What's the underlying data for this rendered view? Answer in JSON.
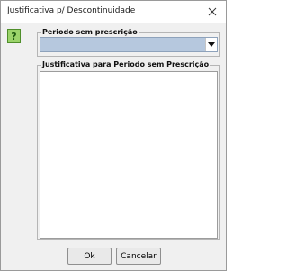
{
  "window": {
    "title": "Justificativa p/ Descontinuidade",
    "close_icon": "close-icon"
  },
  "help_icon": {
    "glyph": "?",
    "icon": "question-icon",
    "color": "#9bd36a"
  },
  "periodo": {
    "label": "Periodo sem prescrição",
    "selected_value": "",
    "highlight_color": "#b6c8de"
  },
  "justificativa": {
    "label": "Justificativa para Periodo sem Prescrição",
    "value": ""
  },
  "buttons": {
    "ok_label": "Ok",
    "cancel_label": "Cancelar"
  }
}
